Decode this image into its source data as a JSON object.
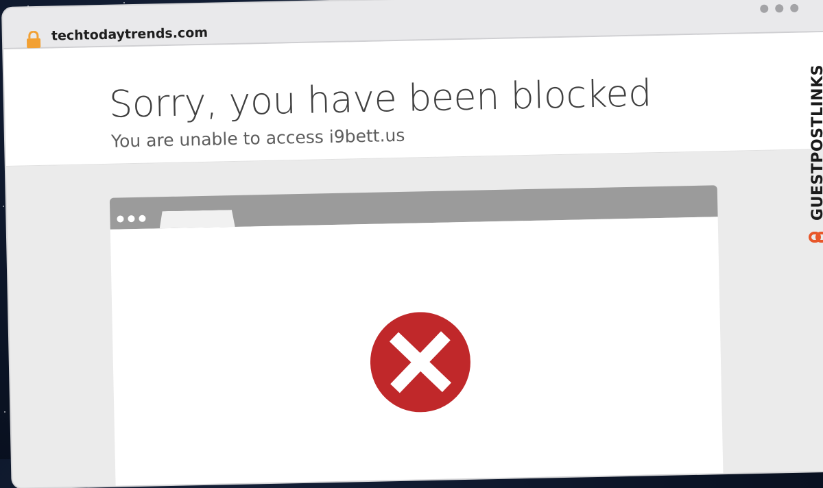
{
  "browser": {
    "url": "techtodaytrends.com"
  },
  "page": {
    "title": "Sorry, you have been blocked",
    "subtitle": "You are unable to access i9bett.us"
  },
  "watermark": {
    "text": "GUESTPOSTLINKS"
  },
  "icons": {
    "lock": "lock-icon",
    "error": "error-x-icon",
    "brand": "link-logo-icon"
  },
  "colors": {
    "error_red": "#c0282a",
    "lock_orange": "#f2a033",
    "brand_orange": "#e8572a"
  }
}
